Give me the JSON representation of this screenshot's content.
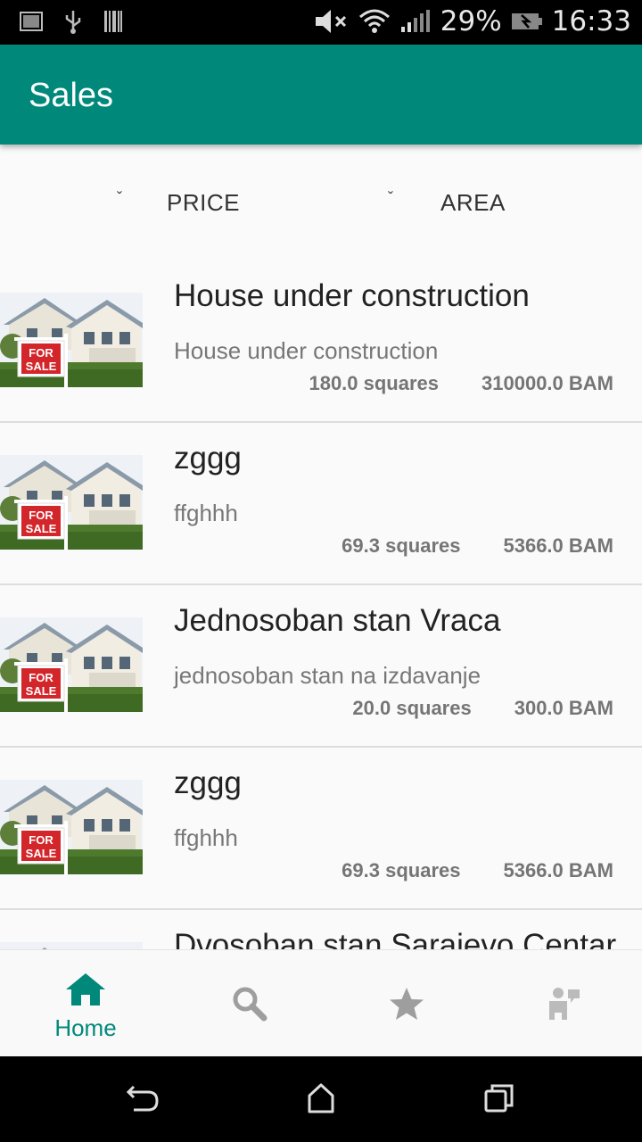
{
  "status_bar": {
    "battery": "29%",
    "time": "16:33",
    "icons": [
      "image-notification-icon",
      "usb-icon",
      "barcode-icon",
      "mute-icon",
      "wifi-icon",
      "signal-icon",
      "battery-icon"
    ]
  },
  "app_bar": {
    "title": "Sales"
  },
  "sort": {
    "price_label": "PRICE",
    "area_label": "AREA",
    "caret": "ˇ"
  },
  "listings": [
    {
      "title": "House under construction",
      "description": "House under construction",
      "area": "180.0 squares",
      "price": "310000.0 BAM"
    },
    {
      "title": "zggg",
      "description": "ffghhh",
      "area": "69.3 squares",
      "price": "5366.0 BAM"
    },
    {
      "title": "Jednosoban stan Vraca",
      "description": "jednosoban stan na izdavanje",
      "area": "20.0 squares",
      "price": "300.0 BAM"
    },
    {
      "title": "zggg",
      "description": "ffghhh",
      "area": "69.3 squares",
      "price": "5366.0 BAM"
    },
    {
      "title": "Dvosoban stan Sarajevo Centar",
      "description": "",
      "area": "",
      "price": ""
    }
  ],
  "thumbnail_sign": {
    "line1": "FOR",
    "line2": "SALE"
  },
  "bottom_nav": {
    "home_label": "Home",
    "items": [
      "home-icon",
      "search-icon",
      "star-icon",
      "profile-icon"
    ],
    "active_color": "#00897b",
    "inactive_color": "#9e9e9e"
  },
  "colors": {
    "primary": "#00897b"
  }
}
